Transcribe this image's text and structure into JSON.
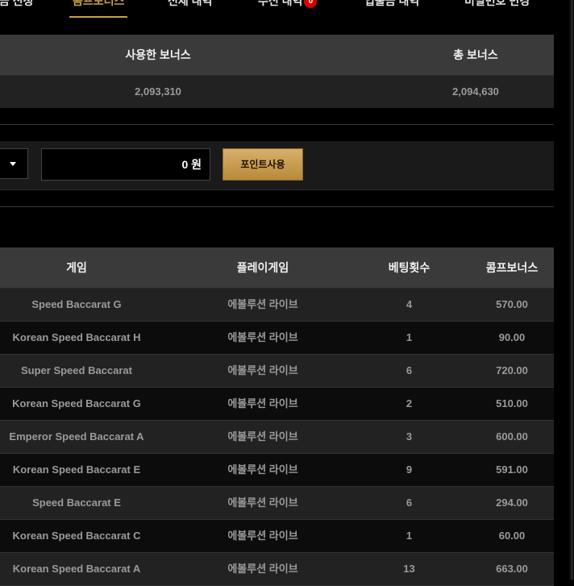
{
  "tabs": [
    {
      "label": "입금 신청"
    },
    {
      "label": "콤프보너스"
    },
    {
      "label": "전체 내역"
    },
    {
      "label": "수신 내역",
      "badge": "0"
    },
    {
      "label": "입출금 내역"
    },
    {
      "label": "비밀번호 변경"
    }
  ],
  "summary": {
    "headers": {
      "used": "사용한 보너스",
      "total": "총 보너스"
    },
    "values": {
      "used": "2,093,310",
      "total": "2,094,630"
    }
  },
  "point": {
    "amount": "0 원",
    "use_button": "포인트사용"
  },
  "table": {
    "headers": {
      "game": "게임",
      "provider": "플레이게임",
      "bets": "베팅횟수",
      "comp": "콤프보너스"
    },
    "rows": [
      {
        "game": "Speed Baccarat G",
        "provider": "에볼루션 라이브",
        "bets": "4",
        "comp": "570.00"
      },
      {
        "game": "Korean Speed Baccarat H",
        "provider": "에볼루션 라이브",
        "bets": "1",
        "comp": "90.00"
      },
      {
        "game": "Super Speed Baccarat",
        "provider": "에볼루션 라이브",
        "bets": "6",
        "comp": "720.00"
      },
      {
        "game": "Korean Speed Baccarat G",
        "provider": "에볼루션 라이브",
        "bets": "2",
        "comp": "510.00"
      },
      {
        "game": "Emperor Speed Baccarat A",
        "provider": "에볼루션 라이브",
        "bets": "3",
        "comp": "600.00"
      },
      {
        "game": "Korean Speed Baccarat E",
        "provider": "에볼루션 라이브",
        "bets": "9",
        "comp": "591.00"
      },
      {
        "game": "Speed Baccarat E",
        "provider": "에볼루션 라이브",
        "bets": "6",
        "comp": "294.00"
      },
      {
        "game": "Korean Speed Baccarat C",
        "provider": "에볼루션 라이브",
        "bets": "1",
        "comp": "60.00"
      },
      {
        "game": "Korean Speed Baccarat A",
        "provider": "에볼루션 라이브",
        "bets": "13",
        "comp": "663.00"
      }
    ]
  }
}
